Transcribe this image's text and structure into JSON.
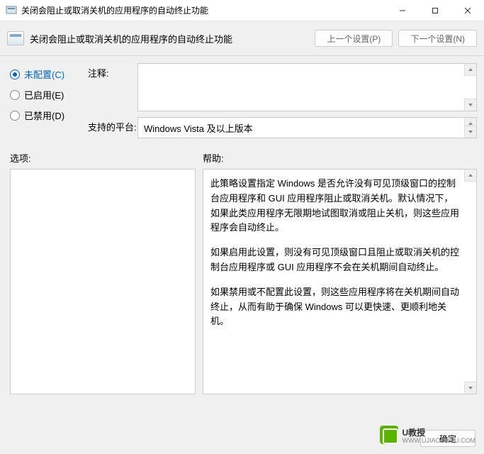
{
  "titlebar": {
    "title": "关闭会阻止或取消关机的应用程序的自动终止功能"
  },
  "header": {
    "title": "关闭会阻止或取消关机的应用程序的自动终止功能",
    "prev": "上一个设置(P)",
    "next": "下一个设置(N)"
  },
  "radios": {
    "notconfigured": "未配置(C)",
    "enabled": "已启用(E)",
    "disabled": "已禁用(D)"
  },
  "fields": {
    "comment_label": "注释:",
    "platform_label": "支持的平台:",
    "platform_value": "Windows Vista 及以上版本"
  },
  "sections": {
    "options": "选项:",
    "help": "帮助:"
  },
  "help_text": {
    "p1": "此策略设置指定 Windows 是否允许没有可见顶级窗口的控制台应用程序和 GUI 应用程序阻止或取消关机。默认情况下，如果此类应用程序无限期地试图取消或阻止关机，则这些应用程序会自动终止。",
    "p2": "如果启用此设置，则没有可见顶级窗口且阻止或取消关机的控制台应用程序或 GUI 应用程序不会在关机期间自动终止。",
    "p3": "如果禁用或不配置此设置，则这些应用程序将在关机期间自动终止，从而有助于确保 Windows 可以更快速、更顺利地关机。"
  },
  "footer": {
    "ok": "确定"
  },
  "watermark": {
    "brand": "U教授",
    "url": "WWW.UJIAOSHOU.COM"
  }
}
